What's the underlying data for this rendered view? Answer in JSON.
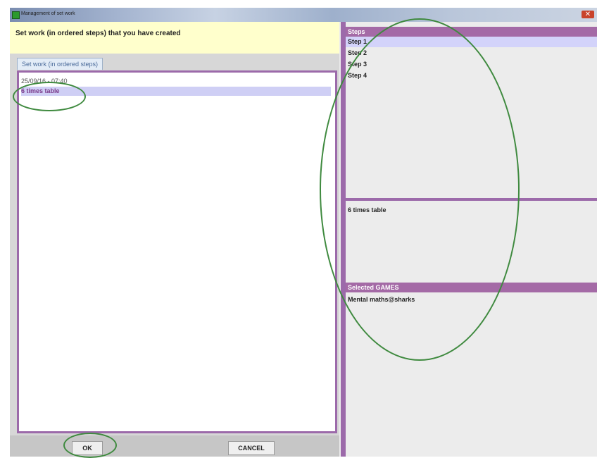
{
  "window": {
    "title": "Management of set work",
    "close_glyph": "✕"
  },
  "left_panel": {
    "header": "Set work (in ordered steps) that you have created",
    "tab_label": "Set work (in ordered steps)",
    "list_items": [
      "25/09/16 - 07:40",
      "6 times table"
    ],
    "selected_index": 1
  },
  "buttons": {
    "ok": "OK",
    "cancel": "CANCEL"
  },
  "right_panel": {
    "steps_header": "Steps",
    "steps": [
      "Step 1",
      "Step 2",
      "Step 3",
      "Step 4"
    ],
    "selected_step_index": 0,
    "description": "6 times table",
    "games_header": "Selected GAMES",
    "games": [
      "Mental maths@sharks"
    ]
  },
  "colors": {
    "accent_purple": "#a46aa6",
    "selection_blue": "#d3d3fa",
    "header_yellow": "#ffffcc",
    "annotation_green": "#3f8a3f"
  }
}
